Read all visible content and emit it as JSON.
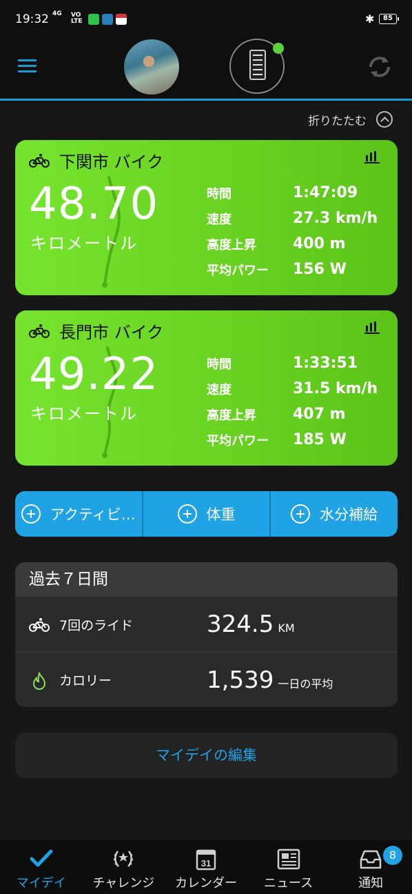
{
  "status_bar": {
    "time": "19:32",
    "network": "4G",
    "volte": "VO LTE",
    "battery": "85"
  },
  "header": {
    "collapse_label": "折りたたむ"
  },
  "activities": [
    {
      "title": "下関市 バイク",
      "distance": "48.70",
      "distance_unit": "キロメートル",
      "stats": [
        {
          "label": "時間",
          "value": "1:47:09"
        },
        {
          "label": "速度",
          "value": "27.3 km/h"
        },
        {
          "label": "高度上昇",
          "value": "400 m"
        },
        {
          "label": "平均パワー",
          "value": "156 W"
        }
      ]
    },
    {
      "title": "長門市 バイク",
      "distance": "49.22",
      "distance_unit": "キロメートル",
      "stats": [
        {
          "label": "時間",
          "value": "1:33:51"
        },
        {
          "label": "速度",
          "value": "31.5 km/h"
        },
        {
          "label": "高度上昇",
          "value": "407 m"
        },
        {
          "label": "平均パワー",
          "value": "185 W"
        }
      ]
    }
  ],
  "quick_add": [
    {
      "label": "アクティビ…"
    },
    {
      "label": "体重"
    },
    {
      "label": "水分補給"
    }
  ],
  "summary": {
    "title": "過去７日間",
    "rides_label": "7回のライド",
    "rides_value": "324.5",
    "rides_unit": "KM",
    "calories_label": "カロリー",
    "calories_value": "1,539",
    "calories_unit": "一日の平均"
  },
  "edit_label": "マイデイの編集",
  "nav": [
    {
      "label": "マイデイ"
    },
    {
      "label": "チャレンジ"
    },
    {
      "label": "カレンダー",
      "icon_text": "31"
    },
    {
      "label": "ニュース"
    },
    {
      "label": "通知",
      "badge": "8"
    }
  ],
  "colors": {
    "accent": "#1fa3e4",
    "card_green": "#6ad624",
    "background": "#171717"
  }
}
